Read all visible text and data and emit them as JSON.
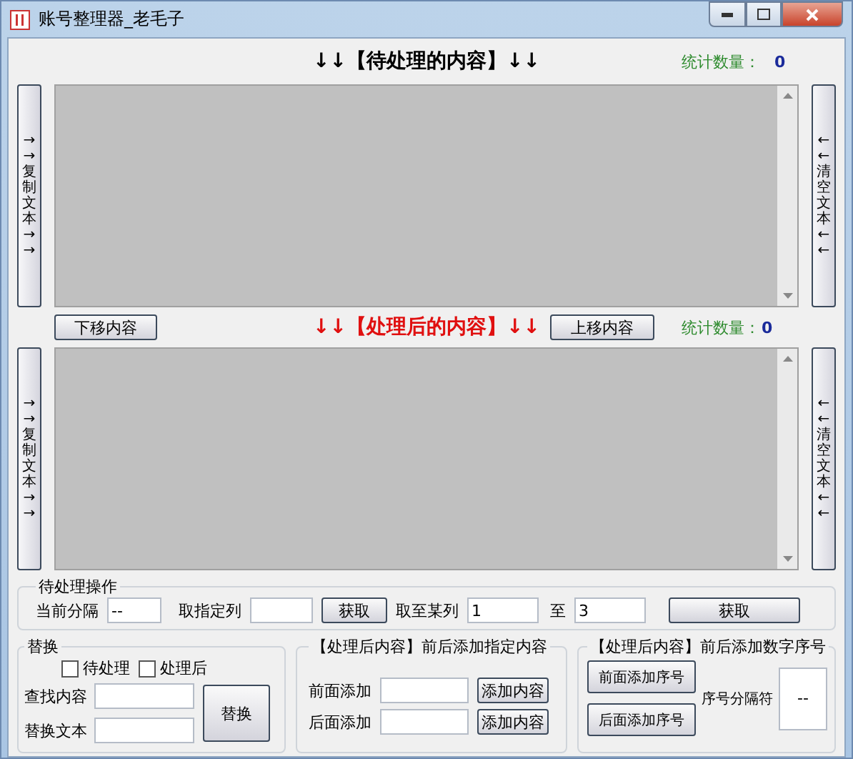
{
  "window": {
    "title": "账号整理器_老毛子"
  },
  "source_panel": {
    "heading": "↓↓【待处理的内容】↓↓",
    "count_label": "统计数量：",
    "count_value": "0",
    "left_button": "→→复制文本→→",
    "right_button": "←←清空文本←←"
  },
  "middle_bar": {
    "move_down": "下移内容",
    "move_up": "上移内容"
  },
  "result_panel": {
    "heading": "↓↓【处理后的内容】↓↓",
    "count_label": "统计数量：",
    "count_value": "0",
    "left_button": "→→复制文本→→",
    "right_button": "←←清空文本←←"
  },
  "pending_ops": {
    "title": "待处理操作",
    "separator_label": "当前分隔",
    "separator_value": "--",
    "column_label": "取指定列",
    "get_button": "获取",
    "range_label": "取至某列",
    "range_from": "1",
    "range_to_label": "至",
    "range_to": "3",
    "range_get_button": "获取"
  },
  "replace": {
    "title": "替换",
    "checkboxes": [
      {
        "label": "待处理",
        "checked": false
      },
      {
        "label": "处理后",
        "checked": false
      }
    ],
    "find_label": "查找内容",
    "replace_label": "替换文本",
    "button": "替换"
  },
  "add_content": {
    "title": "【处理后内容】前后添加指定内容",
    "front_label": "前面添加",
    "back_label": "后面添加",
    "front_button": "添加内容",
    "back_button": "添加内容"
  },
  "add_number": {
    "title": "【处理后内容】前后添加数字序号",
    "front_button": "前面添加序号",
    "back_button": "后面添加序号",
    "separator_label": "序号分隔符",
    "separator_value": "--"
  }
}
